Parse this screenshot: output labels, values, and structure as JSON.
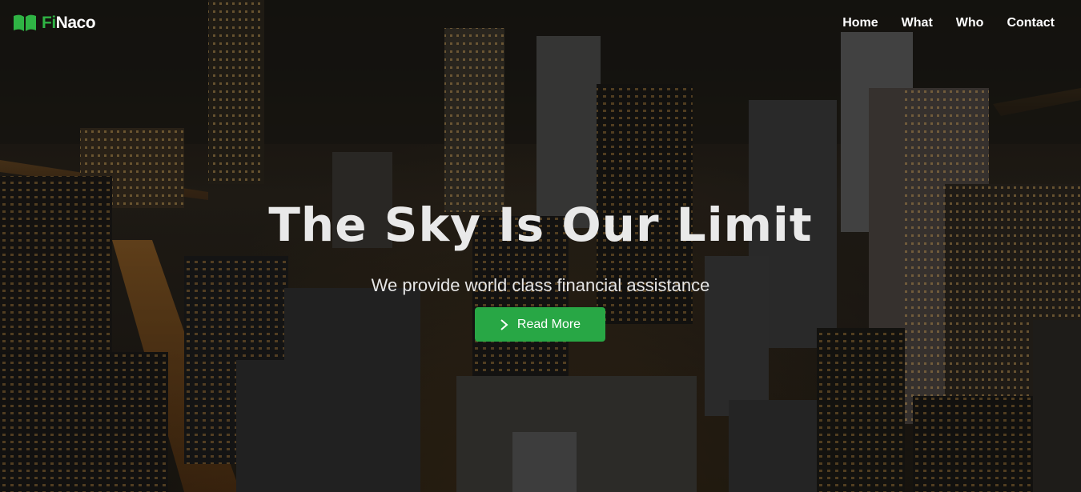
{
  "brand": {
    "name_prefix": "Fi",
    "name_suffix": "Naco",
    "accent_color": "#2fb344",
    "icon": "book-icon"
  },
  "nav": {
    "items": [
      {
        "label": "Home"
      },
      {
        "label": "What"
      },
      {
        "label": "Who"
      },
      {
        "label": "Contact"
      }
    ]
  },
  "hero": {
    "headline": "The Sky Is Our Limit",
    "subheadline": "We provide world class financial assistance",
    "cta_label": "Read More",
    "cta_icon": "chevron-right-icon",
    "cta_color": "#28a745",
    "background": "night city skyline aerial photo"
  }
}
